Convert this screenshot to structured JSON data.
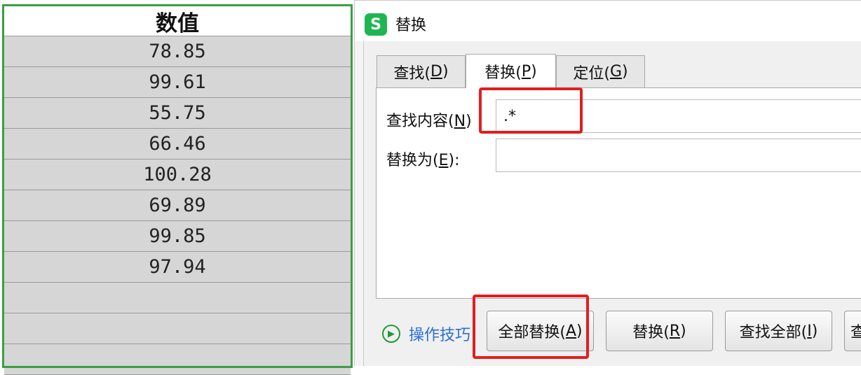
{
  "sheet": {
    "header": "数值",
    "values": [
      "78.85",
      "99.61",
      "55.75",
      "66.46",
      "100.28",
      "69.89",
      "99.85",
      "97.94",
      "",
      "",
      ""
    ]
  },
  "dialog": {
    "app_icon_letter": "S",
    "title": "替换",
    "tabs": [
      {
        "label": "查找(",
        "key": "D",
        "suffix": ")"
      },
      {
        "label": "替换(",
        "key": "P",
        "suffix": ")"
      },
      {
        "label": "定位(",
        "key": "G",
        "suffix": ")"
      }
    ],
    "find_label": "查找内容(",
    "find_key": "N",
    "find_suffix": ")",
    "find_value": ".*",
    "replace_label": "替换为(",
    "replace_key": "E",
    "replace_suffix": "):",
    "replace_value": "",
    "tips_label": "操作技巧",
    "buttons": {
      "replace_all": {
        "label": "全部替换(",
        "key": "A",
        "suffix": ")"
      },
      "replace": {
        "label": "替换(",
        "key": "R",
        "suffix": ")"
      },
      "find_all": {
        "label": "查找全部(",
        "key": "I",
        "suffix": ")"
      },
      "next_partial": "查"
    }
  },
  "colors": {
    "highlight": "#e01f1f",
    "selection": "#3aa043",
    "app_icon": "#20b553",
    "link": "#2a6fd6"
  }
}
